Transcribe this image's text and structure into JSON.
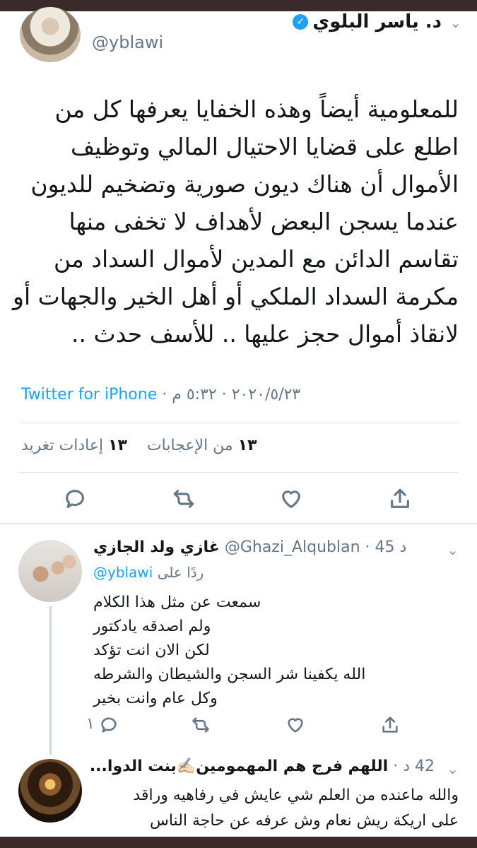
{
  "main_tweet": {
    "display_name": "د. ياسر البلوي",
    "verified_mark": "✓",
    "handle": "@yblawi",
    "body_lines": [
      "للمعلومية أيضاً وهذه الخفايا يعرفها كل من",
      "اطلع على قضايا الاحتيال المالي وتوظيف",
      "الأموال أن هناك ديون صورية وتضخيم للديون",
      "عندما يسجن البعض لأهداف لا تخفى منها",
      "تقاسم الدائن مع المدين لأموال السداد من",
      "مكرمة السداد الملكي أو أهل الخير والجهات أو",
      "لانقاذ أموال حجز عليها .. للأسف حدث .."
    ],
    "source": "Twitter for iPhone",
    "timestamp": " · ٢٠٢٠/٥/٢٣ · ٥:٣٢ م",
    "retweets_count": "١٣",
    "retweets_label": "إعادات تغريد",
    "likes_count": "١٣",
    "likes_label": "من الإعجابات"
  },
  "reply_1": {
    "display_name": "غازي ولد الجازي",
    "handle": "@Ghazi_Alqublan",
    "time": " · 45 د",
    "reply_to_label": "ردًا على",
    "reply_to_handle": "@yblawi",
    "body_lines": [
      "سمعت عن مثل هذا الكلام",
      "ولم اصدقه يادكتور",
      "لكن الان انت تؤكد",
      "الله يكفينا شر السجن والشيطان والشرطه",
      "وكل عام وانت بخير"
    ],
    "reply_count": "١"
  },
  "reply_2": {
    "display_name": "اللهم فرج هم المهمومين✍🏻بنت الدوا...",
    "time": "42 د ·",
    "body_lines": [
      "والله ماعنده من العلم شي عايش في رفاهيه وراقد",
      "على اريكة ريش نعام وش عرفه عن حاجة الناس"
    ]
  },
  "icons": {
    "reply": "reply-icon",
    "retweet": "retweet-icon",
    "like": "heart-icon",
    "share": "share-icon",
    "chevron": "chevron-down-icon"
  },
  "colors": {
    "link": "#1da1f2",
    "secondary_text": "#657786",
    "divider": "#e1e8ed"
  }
}
